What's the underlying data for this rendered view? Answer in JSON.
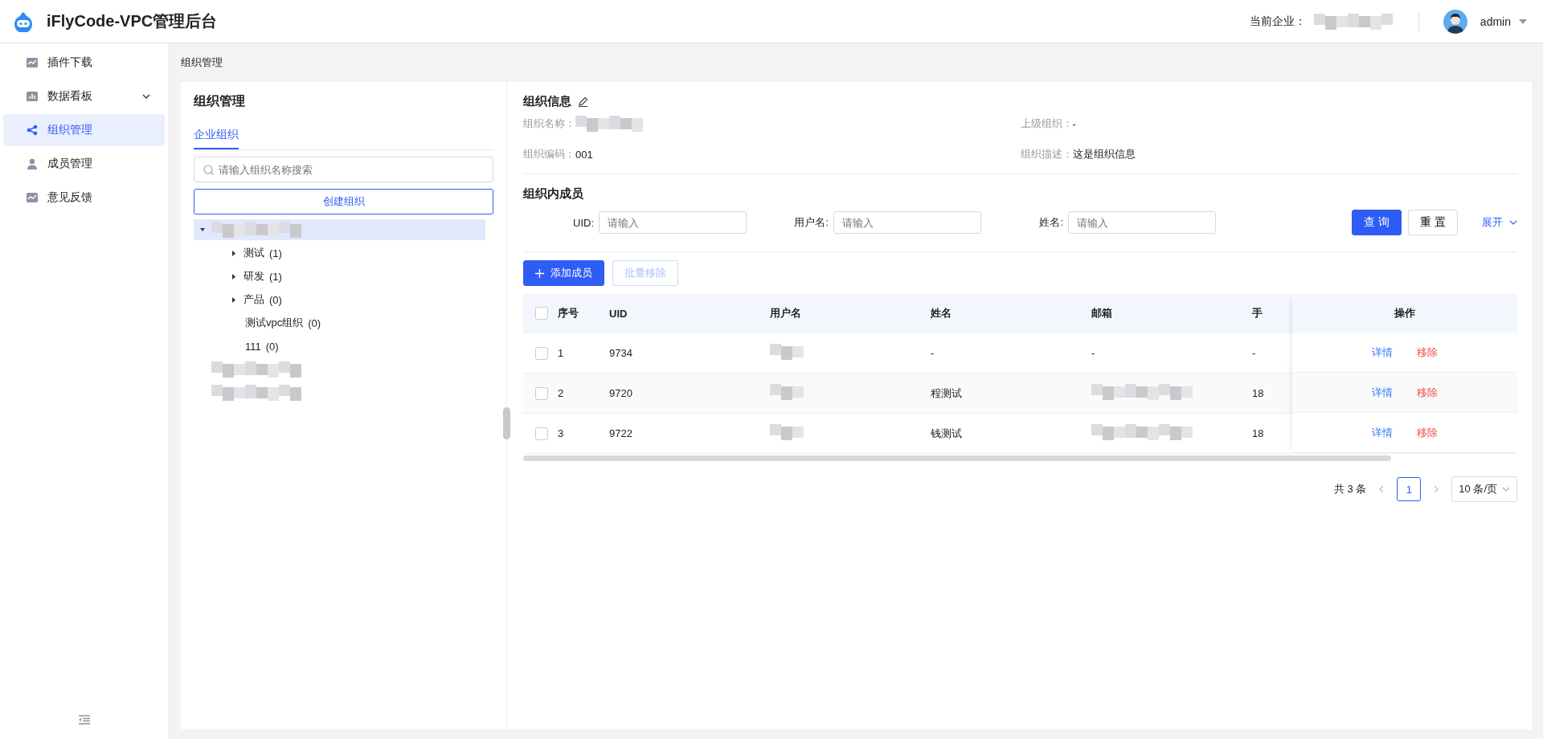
{
  "header": {
    "title": "iFlyCode-VPC管理后台",
    "company_label": "当前企业：",
    "user": "admin"
  },
  "sidebar": {
    "items": [
      {
        "label": "插件下载",
        "kind": "chart",
        "selected": false,
        "has_caret": false
      },
      {
        "label": "数据看板",
        "kind": "bars",
        "selected": false,
        "has_caret": true
      },
      {
        "label": "组织管理",
        "kind": "share",
        "selected": true,
        "has_caret": false
      },
      {
        "label": "成员管理",
        "kind": "user",
        "selected": false,
        "has_caret": false
      },
      {
        "label": "意见反馈",
        "kind": "chart",
        "selected": false,
        "has_caret": false
      }
    ]
  },
  "breadcrumb": "组织管理",
  "org_panel": {
    "title": "组织管理",
    "tabs": [
      {
        "label": "企业组织",
        "selected": true
      }
    ],
    "search": {
      "placeholder": "请输入组织名称搜索"
    },
    "create_button": "创建组织",
    "tree": [
      {
        "redacted": true,
        "selected": true,
        "children": [
          {
            "label": "测试",
            "count": "(1)",
            "expandable": true
          },
          {
            "label": "研发",
            "count": "(1)",
            "expandable": true
          },
          {
            "label": "产品",
            "count": "(0)",
            "expandable": true
          },
          {
            "label": "测试vpc组织",
            "count": "(0)",
            "expandable": false
          },
          {
            "label": "111",
            "count": "(0)",
            "expandable": false
          }
        ]
      },
      {
        "redacted": true,
        "selected": false
      },
      {
        "redacted": true,
        "selected": false
      }
    ]
  },
  "org_info": {
    "title": "组织信息",
    "fields": [
      {
        "label": "组织名称：",
        "redacted": true
      },
      {
        "label": "上级组织：",
        "value": "-"
      },
      {
        "label": "组织编码：",
        "value": "001"
      },
      {
        "label": "组织描述：",
        "value": "这是组织信息"
      }
    ]
  },
  "members": {
    "title": "组织内成员",
    "filters": [
      {
        "label": "UID:",
        "placeholder": "请输入"
      },
      {
        "label": "用户名:",
        "placeholder": "请输入"
      },
      {
        "label": "姓名:",
        "placeholder": "请输入"
      }
    ],
    "query_button": "查 询",
    "reset_button": "重 置",
    "expand_link": "展开",
    "add_button": "添加成员",
    "batch_remove_button": "批量移除",
    "batch_remove_disabled": true,
    "table": {
      "all_checked": false,
      "columns": [
        "序号",
        "UID",
        "用户名",
        "姓名",
        "邮箱",
        "手"
      ],
      "action_column": "操作",
      "rows": [
        {
          "index": "1",
          "uid": "9734",
          "username_redacted": true,
          "name": "-",
          "email": "-",
          "email_redacted": false,
          "phone": "-",
          "checked": false,
          "actions": [
            "详情",
            "移除"
          ]
        },
        {
          "index": "2",
          "uid": "9720",
          "username_redacted": true,
          "name": "程测试",
          "email_redacted": true,
          "phone": "18",
          "checked": false,
          "actions": [
            "详情",
            "移除"
          ]
        },
        {
          "index": "3",
          "uid": "9722",
          "username_redacted": true,
          "name": "钱测试",
          "email_redacted": true,
          "phone": "18",
          "checked": false,
          "actions": [
            "详情",
            "移除"
          ]
        }
      ]
    },
    "pagination": {
      "total": "共 3 条",
      "pages": [
        {
          "label": "1",
          "selected": true
        }
      ],
      "page_size": "10 条/页"
    }
  }
}
